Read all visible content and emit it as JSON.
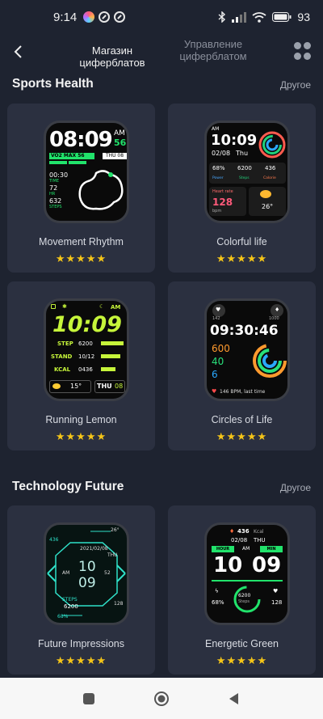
{
  "status": {
    "time": "9:14",
    "battery": "93"
  },
  "header": {
    "tab_store": "Магазин циферблатов",
    "tab_manage": "Управление циферблатом"
  },
  "sections": [
    {
      "title": "Sports Health",
      "more": "Другое"
    },
    {
      "title": "Technology Future",
      "more": "Другое"
    }
  ],
  "cards": [
    {
      "name": "Movement Rhythm",
      "rating": 5
    },
    {
      "name": "Colorful life",
      "rating": 5
    },
    {
      "name": "Running Lemon",
      "rating": 5
    },
    {
      "name": "Circles of Life",
      "rating": 5
    },
    {
      "name": "Future Impressions",
      "rating": 5
    },
    {
      "name": "Energetic Green",
      "rating": 5
    }
  ],
  "faces": {
    "w1": {
      "time": "08:09",
      "ampm": "AM",
      "num": "56",
      "tag": "VO2 MAX 56",
      "day": "THU 08",
      "d1": "00:30",
      "d1l": "TIME",
      "d2": "72",
      "d2l": "HR",
      "d3": "632",
      "d3l": "STEPS"
    },
    "w2": {
      "ampm": "AM",
      "time": "10:09",
      "date": "02/08",
      "day": "Thu",
      "s1": "68%",
      "s1l": "Power",
      "s2": "6200",
      "s2l": "Steps",
      "s3": "436",
      "s3l": "Calorie",
      "hr_label": "Heart rate",
      "hr": "128",
      "hr_unit": "bpm",
      "temp": "26°"
    },
    "w3": {
      "ampm": "AM",
      "time": "10:09",
      "l1": "STEP",
      "v1": "6200",
      "l2": "STAND",
      "v2": "10/12",
      "l3": "KCAL",
      "v3": "0436",
      "temp": "15°",
      "day": "THU",
      "daynum": "08"
    },
    "w4": {
      "top_l": "142",
      "top_r": "1000",
      "time": "09:30:46",
      "n1": "600",
      "n2": "40",
      "n3": "6",
      "bpm": "146 BPM, last time"
    },
    "w5": {
      "pct_top": "436",
      "temp": "26°",
      "date": "2021/02/08",
      "day": "THU",
      "h": "10",
      "m": "09",
      "am": "AM",
      "s": "52",
      "steps_label": "STEPS",
      "steps": "6200",
      "num_r": "128",
      "pct": "68%"
    },
    "w6": {
      "kcal": "436",
      "kcal_unit": "Kcal",
      "date": "02/08",
      "day": "THU",
      "hour_l": "HOUR",
      "am": "AM",
      "min_l": "MIN",
      "h": "10",
      "m": "09",
      "pct": "68%",
      "steps": "6200",
      "steps_label": "Steps",
      "hr": "128"
    }
  },
  "colors": {
    "accent": "#f5c518",
    "lemon": "#c6f53a",
    "green": "#21e36b",
    "teal": "#2fe0c8"
  }
}
